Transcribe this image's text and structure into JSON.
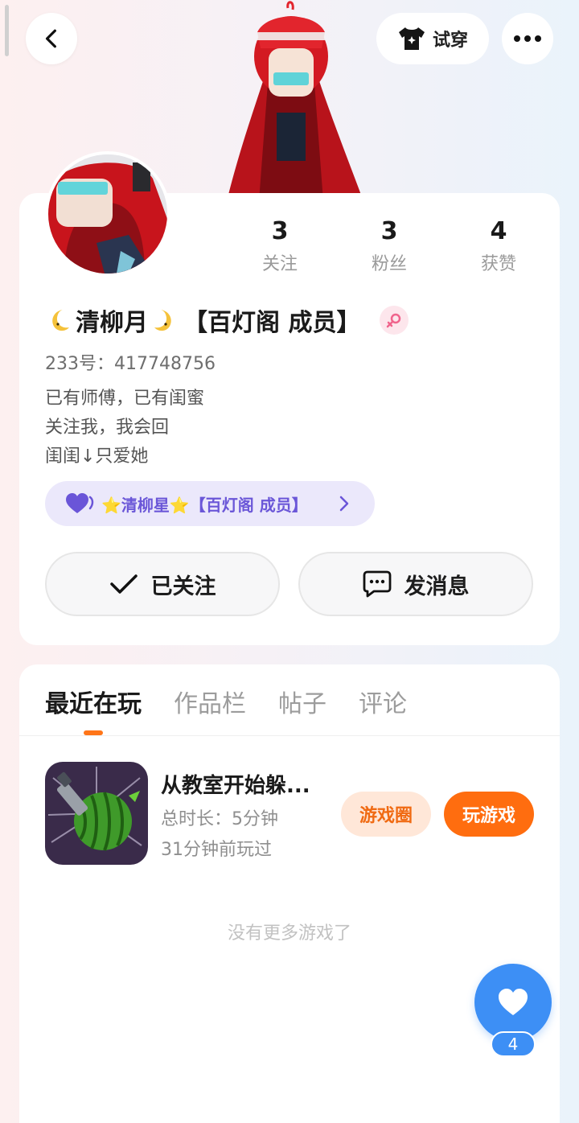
{
  "header": {
    "try_on_label": "试穿"
  },
  "profile": {
    "stats": [
      {
        "value": "3",
        "label": "关注"
      },
      {
        "value": "3",
        "label": "粉丝"
      },
      {
        "value": "4",
        "label": "获赞"
      }
    ],
    "name": "清柳月",
    "guild_tag": "【百灯阁 成员】",
    "uid": "233号：417748756",
    "bio": [
      "已有师傅，已有闺蜜",
      "关注我，我会回",
      "闺闺↓只爱她"
    ],
    "bff_label": "⭐清柳星⭐【百灯阁 成员】",
    "follow_button": "已关注",
    "message_button": "发消息"
  },
  "tabs": [
    "最近在玩",
    "作品栏",
    "帖子",
    "评论"
  ],
  "game": {
    "title": "从教室开始躲...",
    "duration": "总时长：5分钟",
    "last_played": "31分钟前玩过",
    "circle_button": "游戏圈",
    "play_button": "玩游戏"
  },
  "empty_message": "没有更多游戏了",
  "like": {
    "count": "4"
  },
  "colors": {
    "accent_orange": "#ff6d0f",
    "like_blue": "#3d8ff5",
    "bff_purple": "#6b57d8"
  }
}
